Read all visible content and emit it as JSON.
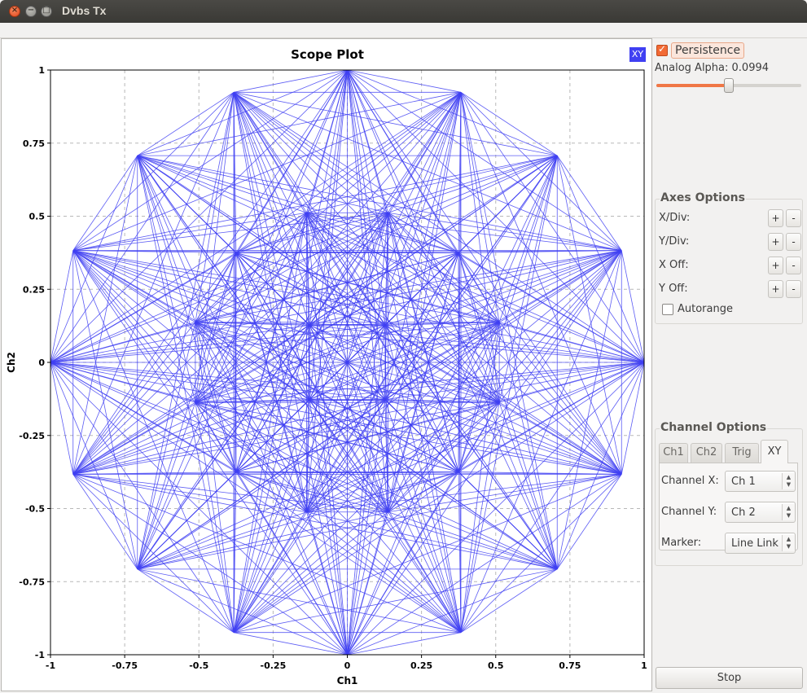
{
  "window": {
    "title": "Dvbs Tx",
    "close_glyph": "×",
    "minimize_glyph": "−",
    "maximize_glyph": "□"
  },
  "plot": {
    "title": "Scope Plot",
    "mode_badge": "XY",
    "trace_color": "#4040f2"
  },
  "chart_data": {
    "type": "scatter",
    "title": "Scope Plot",
    "xlabel": "Ch1",
    "ylabel": "Ch2",
    "xlim": [
      -1,
      1
    ],
    "ylim": [
      -1,
      1
    ],
    "grid": true,
    "connected": true,
    "x_ticks": [
      "-1",
      "-0.75",
      "-0.5",
      "-0.25",
      "0",
      "0.25",
      "0.5",
      "0.75",
      "1"
    ],
    "y_ticks": [
      "-1",
      "-0.75",
      "-0.5",
      "-0.25",
      "0",
      "0.25",
      "0.5",
      "0.75",
      "1"
    ],
    "constellation": {
      "outer_ring": {
        "radius": 1.0,
        "points": 16,
        "phase_deg": 0
      },
      "middle_ring": {
        "radius": 0.53,
        "points": 12,
        "phase_deg": 15
      },
      "inner_ring": {
        "radius": 0.18,
        "points": 4,
        "phase_deg": 45
      }
    }
  },
  "controls": {
    "persistence_label": "Persistence",
    "persistence_checked": true,
    "alpha_label": "Analog Alpha: 0.0994",
    "alpha_fraction": 0.5
  },
  "axes_options": {
    "title": "Axes Options",
    "rows": [
      {
        "label": "X/Div:",
        "plus": "+",
        "minus": "-"
      },
      {
        "label": "Y/Div:",
        "plus": "+",
        "minus": "-"
      },
      {
        "label": "X Off:",
        "plus": "+",
        "minus": "-"
      },
      {
        "label": "Y Off:",
        "plus": "+",
        "minus": "-"
      }
    ],
    "autorange_label": "Autorange",
    "autorange_checked": false
  },
  "channel_options": {
    "title": "Channel Options",
    "tabs": [
      "Ch1",
      "Ch2",
      "Trig",
      "XY"
    ],
    "active_tab": "XY",
    "channel_x_label": "Channel X:",
    "channel_x_value": "Ch 1",
    "channel_y_label": "Channel Y:",
    "channel_y_value": "Ch 2",
    "marker_label": "Marker:",
    "marker_value": "Line Link"
  },
  "stop_button": "Stop"
}
